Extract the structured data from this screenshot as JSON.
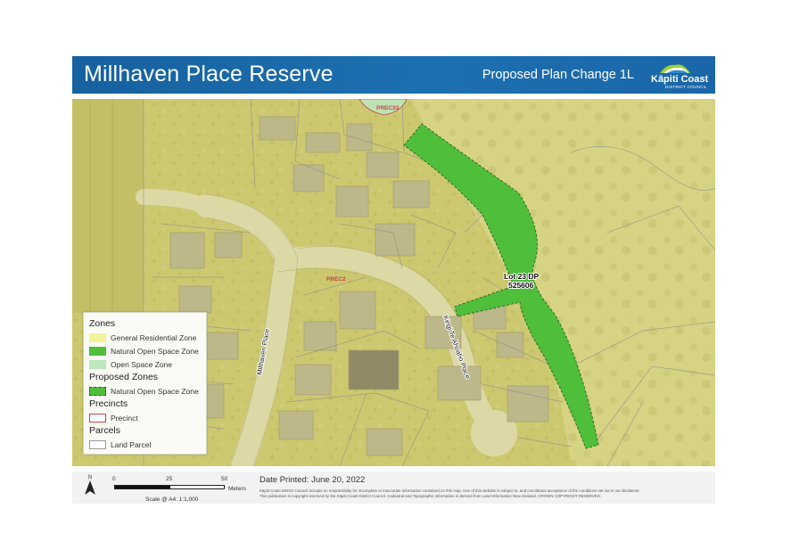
{
  "header": {
    "title": "Millhaven Place Reserve",
    "subtitle": "Proposed Plan Change 1L",
    "logo_name": "Kāpiti Coast",
    "logo_sub": "DISTRICT COUNCIL"
  },
  "map": {
    "labels": {
      "precinct_top": "PREC33",
      "precinct_mid": "PREC2",
      "lot_line1": "Lot 23 DP",
      "lot_line2": "525606",
      "street_millhaven": "Millhaven Place",
      "street_kingi": "Kingi Te Ahoaho Place"
    }
  },
  "legend": {
    "zones_heading": "Zones",
    "zones": [
      {
        "label": "General Residential Zone",
        "color": "#f4f29a"
      },
      {
        "label": "Natural Open Space Zone",
        "color": "#4fbe3b"
      },
      {
        "label": "Open Space Zone",
        "color": "#bfe7bd"
      }
    ],
    "proposed_heading": "Proposed Zones",
    "proposed": [
      {
        "label": "Natural Open Space Zone",
        "color": "#4fbe3b"
      }
    ],
    "precincts_heading": "Precincts",
    "precincts": [
      {
        "label": "Precinct",
        "color": "#c2454a"
      }
    ],
    "parcels_heading": "Parcels",
    "parcels": [
      {
        "label": "Land Parcel",
        "color": "#9a9a9a"
      }
    ]
  },
  "footer": {
    "north": "N",
    "scale_ticks": [
      "0",
      "25",
      "50"
    ],
    "scale_units": "Meters",
    "scale_note": "Scale @ A4: 1:1,000",
    "date_printed": "Date Printed: June 20, 2022",
    "disclaimer_1": "Kāpiti Coast District Council accepts no responsibility for incomplete or inaccurate information contained on this map. Use of this website is subject to, and constitutes acceptance of the conditions set out in our disclaimer.",
    "disclaimer_2": "This publication is copyright reserved by the Kāpiti Coast District Council. Cadastral and Topographic information is derived from Land Information New Zealand. CROWN COPYRIGHT RESERVED."
  }
}
